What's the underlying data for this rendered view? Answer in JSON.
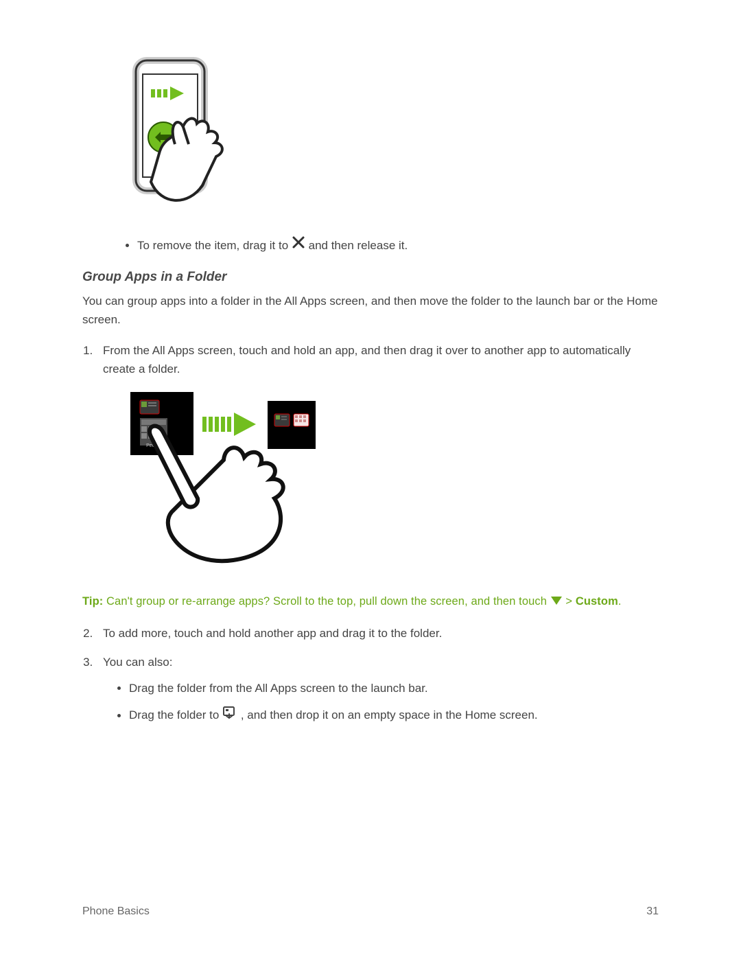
{
  "bullet1": {
    "pre": "To remove the item, drag it to ",
    "post": " and then release it."
  },
  "heading": "Group Apps in a Folder",
  "intro": "You can group apps into a folder in the All Apps screen, and then move the folder to the launch bar or the Home screen.",
  "step1": "From the All Apps screen, touch and hold an app, and then drag it over to another app to automatically create a folder.",
  "tip": {
    "label": "Tip:",
    "body": "  Can't group or re-arrange apps? Scroll to the top, pull down the screen, and then touch ",
    "gt": " >",
    "custom": "Custom",
    "period": "."
  },
  "step2": "To add more, touch and hold another app and drag it to the folder.",
  "step3": "You can also:",
  "sub1": "Drag the folder from the All Apps screen to the launch bar.",
  "sub2": {
    "pre": "Drag the folder to ",
    "post": ", and then drop it on an empty space in the Home screen."
  },
  "footer": {
    "left": "Phone Basics",
    "right": "31"
  }
}
